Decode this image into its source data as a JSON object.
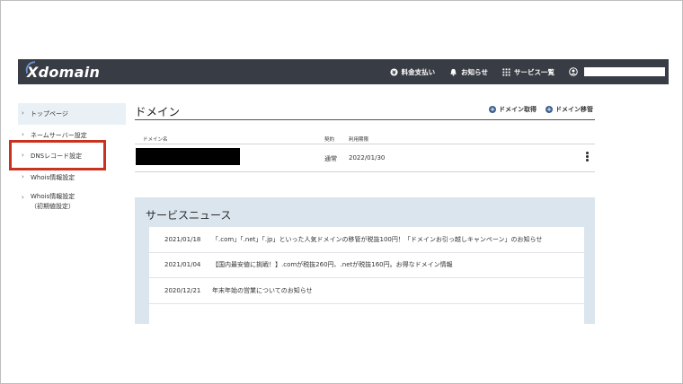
{
  "header": {
    "logo": "Xdomain",
    "nav": [
      {
        "label": "料金支払い",
        "icon": "yen-coin-icon"
      },
      {
        "label": "お知らせ",
        "icon": "bell-icon"
      },
      {
        "label": "サービス一覧",
        "icon": "grid-icon"
      }
    ],
    "user_icon": "user-icon"
  },
  "sidebar": {
    "items": [
      {
        "label": "トップページ"
      },
      {
        "label": "ネームサーバー設定"
      },
      {
        "label": "DNSレコード設定"
      },
      {
        "label": "Whois情報設定"
      },
      {
        "label": "Whois情報設定",
        "sub": "（初期値設定）"
      }
    ],
    "chevron": "›"
  },
  "main": {
    "title": "ドメイン",
    "actions": [
      {
        "label": "ドメイン取得"
      },
      {
        "label": "ドメイン移管"
      }
    ],
    "table": {
      "columns": [
        "ドメイン名",
        "契約",
        "利用期限"
      ],
      "rows": [
        {
          "contract": "通常",
          "expiry": "2022/01/30"
        }
      ]
    }
  },
  "news": {
    "title": "サービスニュース",
    "items": [
      {
        "date": "2021/01/18",
        "text": "「.com」「.net」「.jp」といった人気ドメインの移管が税抜100円！「ドメインお引っ越しキャンペーン」のお知らせ"
      },
      {
        "date": "2021/01/04",
        "text": "【国内最安値に挑戦！】.comが税抜260円、.netが税抜160円。お得なドメイン情報"
      },
      {
        "date": "2020/12/21",
        "text": "年末年始の営業についてのお知らせ"
      }
    ]
  },
  "colors": {
    "header_bg": "#383c44",
    "highlight": "#c8321e",
    "news_bg": "#dbe5ed",
    "accent": "#3b5f8f"
  }
}
